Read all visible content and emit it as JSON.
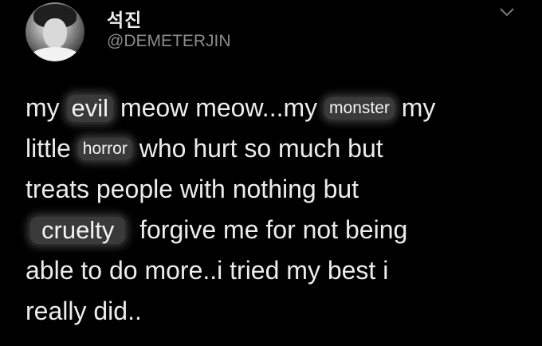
{
  "user": {
    "display_name": "석진",
    "handle": "@DEMETERJIN",
    "avatar_icon": "avatar-photo"
  },
  "menu": {
    "icon": "chevron-down-icon"
  },
  "tweet": {
    "line1": {
      "pre": "my ",
      "evil": "evil",
      "mid": " meow meow...my ",
      "monster": "monster",
      "post": " my"
    },
    "line2": {
      "pre": "little ",
      "horror": "horror",
      "post": " who hurt so much but"
    },
    "line3": "treats people with nothing but",
    "line4": {
      "cruelty": "cruelty",
      "post": "  forgive me for not being"
    },
    "line5": "able to do more..i tried my best i",
    "line6": "really did.."
  },
  "colors": {
    "background": "#000000",
    "text": "#ececec",
    "handle": "#8c8c8c",
    "highlight": "#3a3a3a"
  }
}
